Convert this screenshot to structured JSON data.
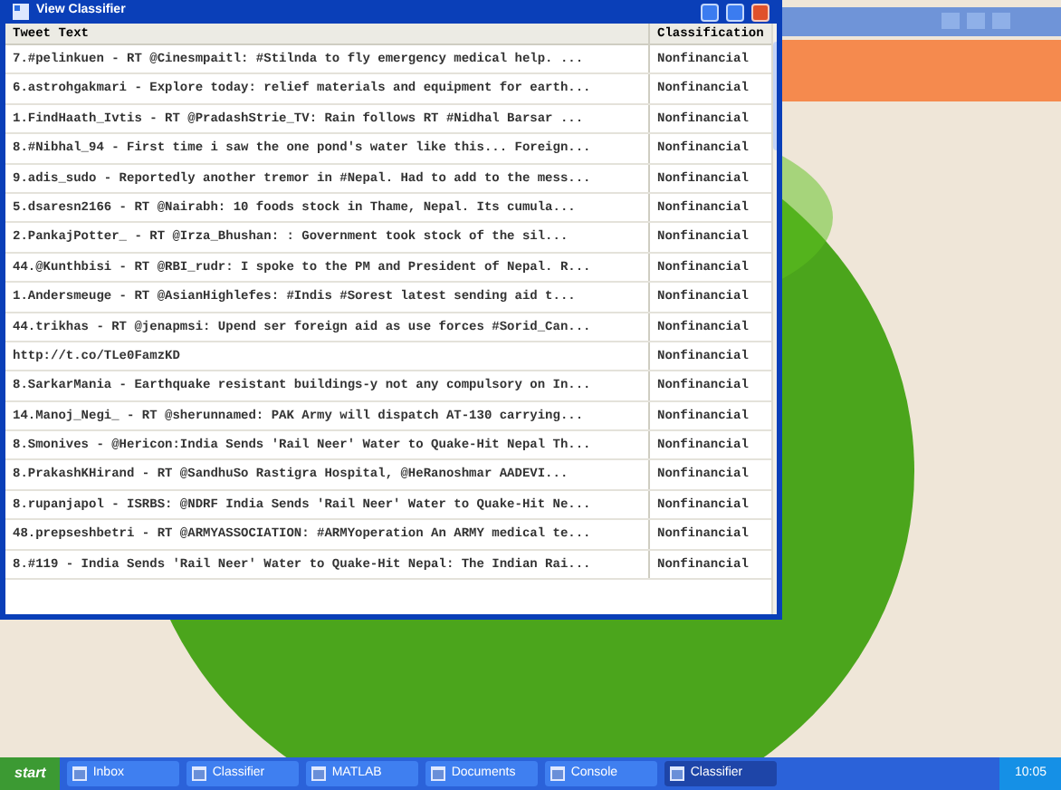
{
  "window": {
    "title": "View Classifier"
  },
  "table": {
    "columns": [
      "Tweet Text",
      "Classification"
    ],
    "rows": [
      {
        "text": "7.#pelinkuen - RT @Cinesmpaitl: #Stilnda to fly emergency medical help. ...",
        "classification": "Nonfinancial"
      },
      {
        "text": "6.astrohgakmari - Explore today: relief materials and equipment for earth...",
        "classification": "Nonfinancial"
      },
      {
        "text": "1.FindHaath_Ivtis - RT @PradashStrie_TV: Rain follows RT #Nidhal Barsar ...",
        "classification": "Nonfinancial"
      },
      {
        "text": "8.#Nibhal_94 - First time i saw the one pond's water like this... Foreign...",
        "classification": "Nonfinancial"
      },
      {
        "text": "9.adis_sudo - Reportedly another tremor in #Nepal. Had to add to the mess...",
        "classification": "Nonfinancial"
      },
      {
        "text": "5.dsaresn2166 - RT @Nairabh: 10 foods stock in Thame, Nepal. Its cumula...",
        "classification": "Nonfinancial"
      },
      {
        "text": "2.PankajPotter_ - RT @Irza_Bhushan: : Government took stock of the sil...",
        "classification": "Nonfinancial"
      },
      {
        "text": "44.@Kunthbisi - RT @RBI_rudr: I spoke to the PM and President of Nepal. R...",
        "classification": "Nonfinancial"
      },
      {
        "text": "1.Andersmeuge - RT @AsianHighlefes: #Indis #Sorest latest sending aid t...",
        "classification": "Nonfinancial"
      },
      {
        "text": "44.trikhas - RT @jenapmsi: Upend ser foreign aid as use forces #Sorid_Can...",
        "classification": "Nonfinancial"
      },
      {
        "text": "http://t.co/TLe0FamzKD",
        "classification": "Nonfinancial"
      },
      {
        "text": "8.SarkarMania - Earthquake resistant buildings-y not any compulsory on In...",
        "classification": "Nonfinancial"
      },
      {
        "text": "14.Manoj_Negi_ - RT @sherunnamed: PAK Army will dispatch AT-130 carrying...",
        "classification": "Nonfinancial"
      },
      {
        "text": "8.Smonives - @Hericon:India Sends 'Rail Neer' Water to Quake-Hit Nepal Th...",
        "classification": "Nonfinancial"
      },
      {
        "text": "8.PrakashKHirand - RT @SandhuSo Rastigra Hospital, @HeRanoshmar AADEVI...",
        "classification": "Nonfinancial"
      },
      {
        "text": "8.rupanjapol - ISRBS: @NDRF India Sends 'Rail Neer' Water to Quake-Hit Ne...",
        "classification": "Nonfinancial"
      },
      {
        "text": "48.prepseshbetri - RT @ARMYASSOCIATION: #ARMYoperation An ARMY medical te...",
        "classification": "Nonfinancial"
      },
      {
        "text": "8.#119 - India Sends 'Rail Neer' Water to Quake-Hit Nepal: The Indian Rai...",
        "classification": "Nonfinancial"
      }
    ]
  },
  "taskbar": {
    "start": "start",
    "items": [
      {
        "label": "Inbox",
        "selected": false
      },
      {
        "label": "Classifier",
        "selected": false
      },
      {
        "label": "MATLAB",
        "selected": false
      },
      {
        "label": "Documents",
        "selected": false
      },
      {
        "label": "Console",
        "selected": false
      },
      {
        "label": "Classifier",
        "selected": true
      }
    ],
    "clock": "10:05"
  }
}
